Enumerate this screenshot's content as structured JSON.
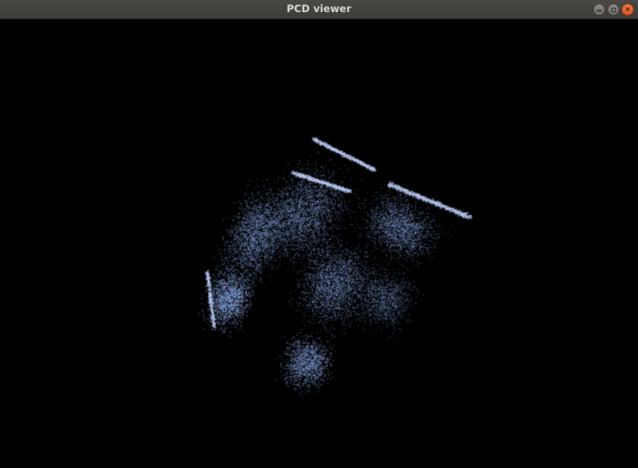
{
  "window": {
    "title": "PCD viewer",
    "controls": {
      "minimize_icon": "minimize-icon",
      "maximize_icon": "maximize-icon",
      "close_icon": "close-icon",
      "close_glyph": "×"
    }
  },
  "viewer": {
    "background_color": "#000000",
    "point_color": "#8aa8e6",
    "highlight_color": "#b9ccf5"
  }
}
